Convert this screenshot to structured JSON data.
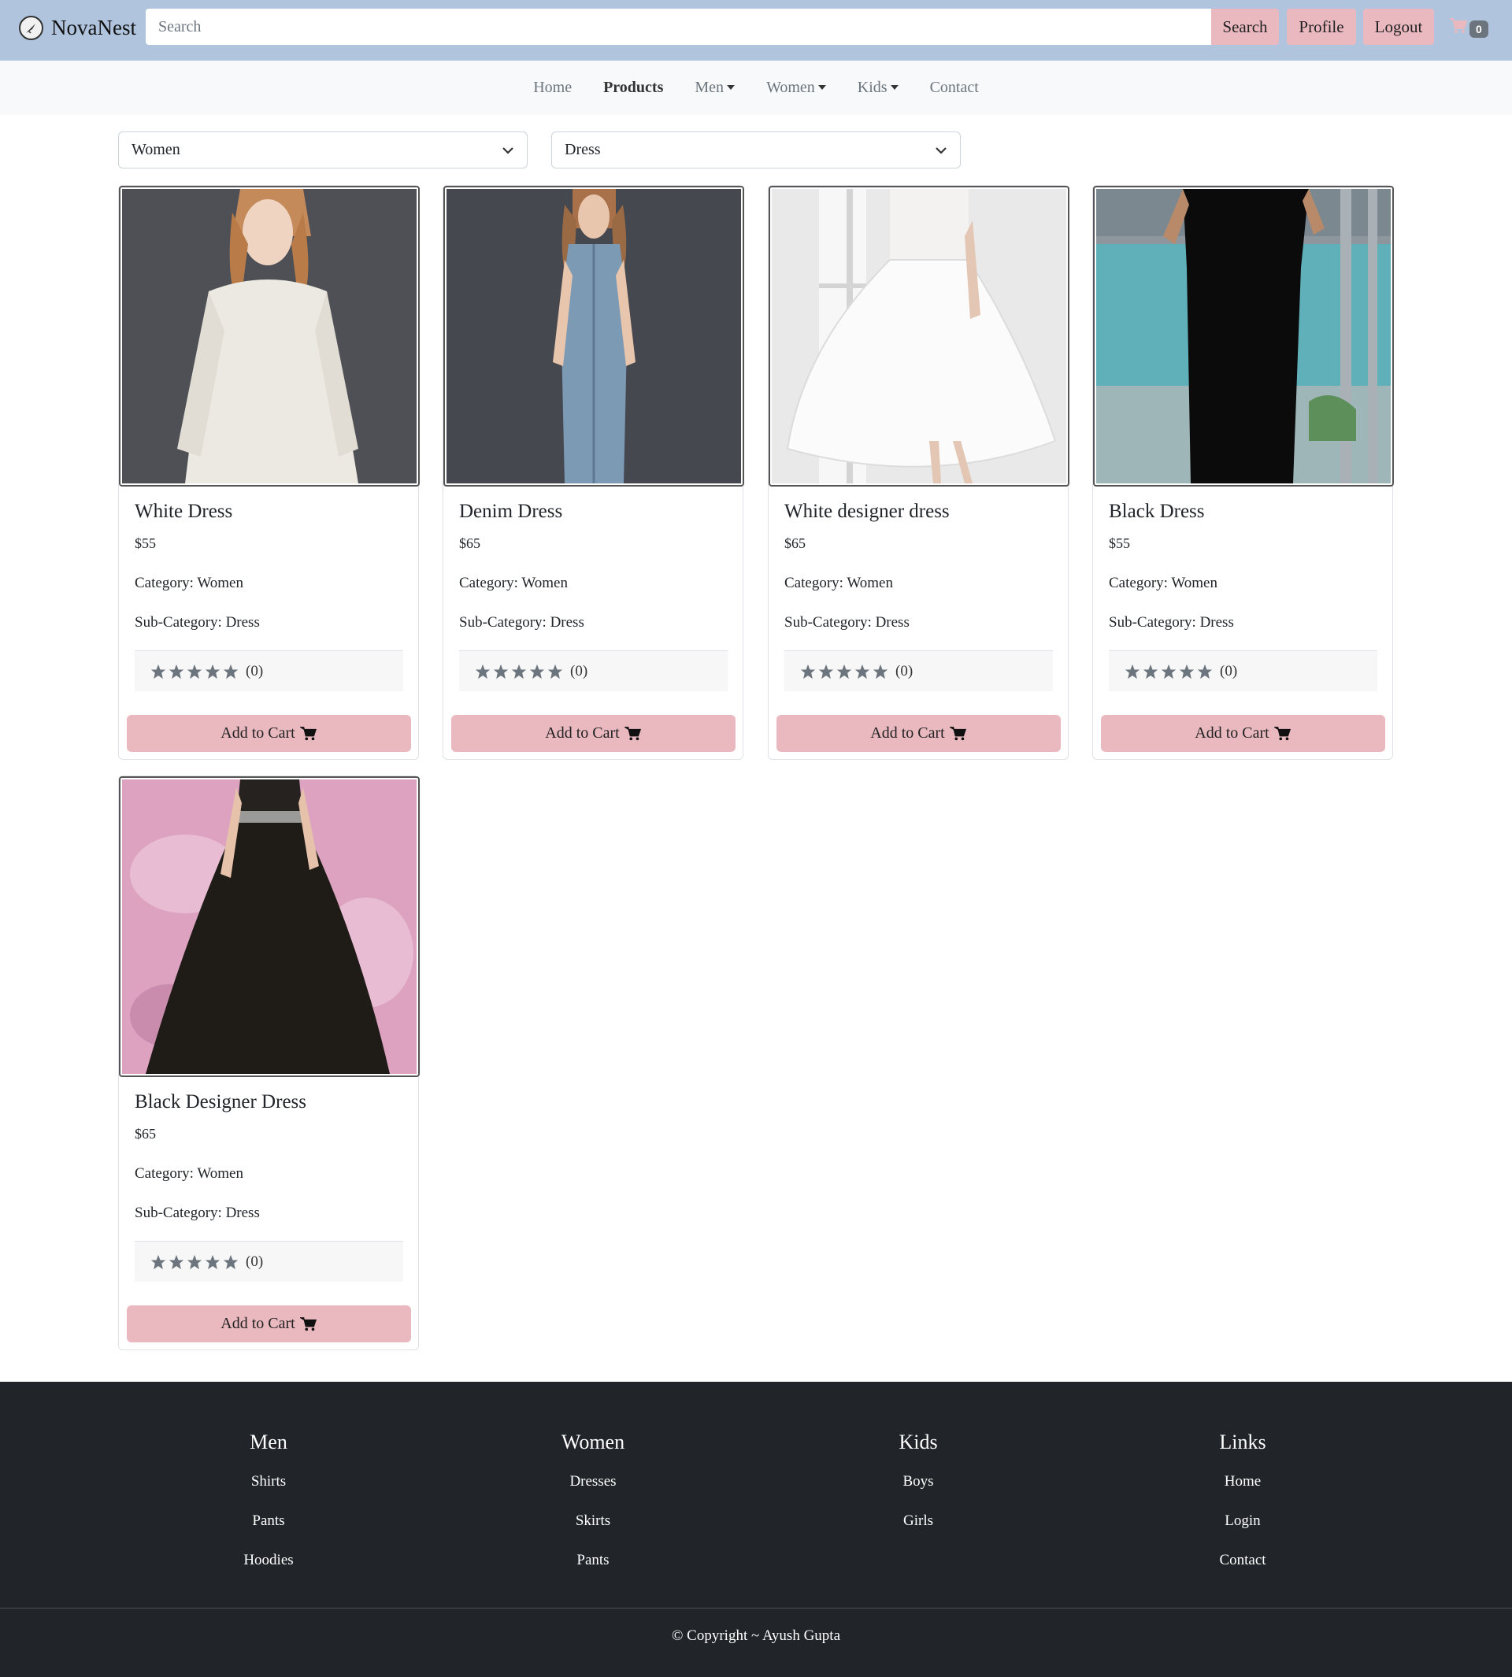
{
  "header": {
    "brand": "NovaNest",
    "search_placeholder": "Search",
    "search_button": "Search",
    "profile_button": "Profile",
    "logout_button": "Logout",
    "cart_count": "0",
    "accent_color": "#eab9c0",
    "bar_color": "#b0c4de"
  },
  "nav": {
    "home": "Home",
    "products": "Products",
    "men": "Men",
    "women": "Women",
    "kids": "Kids",
    "contact": "Contact"
  },
  "filters": {
    "category": "Women",
    "subcategory": "Dress"
  },
  "products": [
    {
      "name": "White Dress",
      "price": "$55",
      "category": "Category: Women",
      "subcategory": "Sub-Category: Dress",
      "rating_count": "(0)",
      "button": "Add to Cart"
    },
    {
      "name": "Denim Dress",
      "price": "$65",
      "category": "Category: Women",
      "subcategory": "Sub-Category: Dress",
      "rating_count": "(0)",
      "button": "Add to Cart"
    },
    {
      "name": "White designer dress",
      "price": "$65",
      "category": "Category: Women",
      "subcategory": "Sub-Category: Dress",
      "rating_count": "(0)",
      "button": "Add to Cart"
    },
    {
      "name": "Black Dress",
      "price": "$55",
      "category": "Category: Women",
      "subcategory": "Sub-Category: Dress",
      "rating_count": "(0)",
      "button": "Add to Cart"
    },
    {
      "name": "Black Designer Dress",
      "price": "$65",
      "category": "Category: Women",
      "subcategory": "Sub-Category: Dress",
      "rating_count": "(0)",
      "button": "Add to Cart"
    }
  ],
  "footer": {
    "columns": [
      {
        "heading": "Men",
        "links": [
          "Shirts",
          "Pants",
          "Hoodies"
        ]
      },
      {
        "heading": "Women",
        "links": [
          "Dresses",
          "Skirts",
          "Pants"
        ]
      },
      {
        "heading": "Kids",
        "links": [
          "Boys",
          "Girls"
        ]
      },
      {
        "heading": "Links",
        "links": [
          "Home",
          "Login",
          "Contact"
        ]
      }
    ],
    "copyright": "© Copyright ~ Ayush Gupta",
    "bg_color": "#212529"
  }
}
